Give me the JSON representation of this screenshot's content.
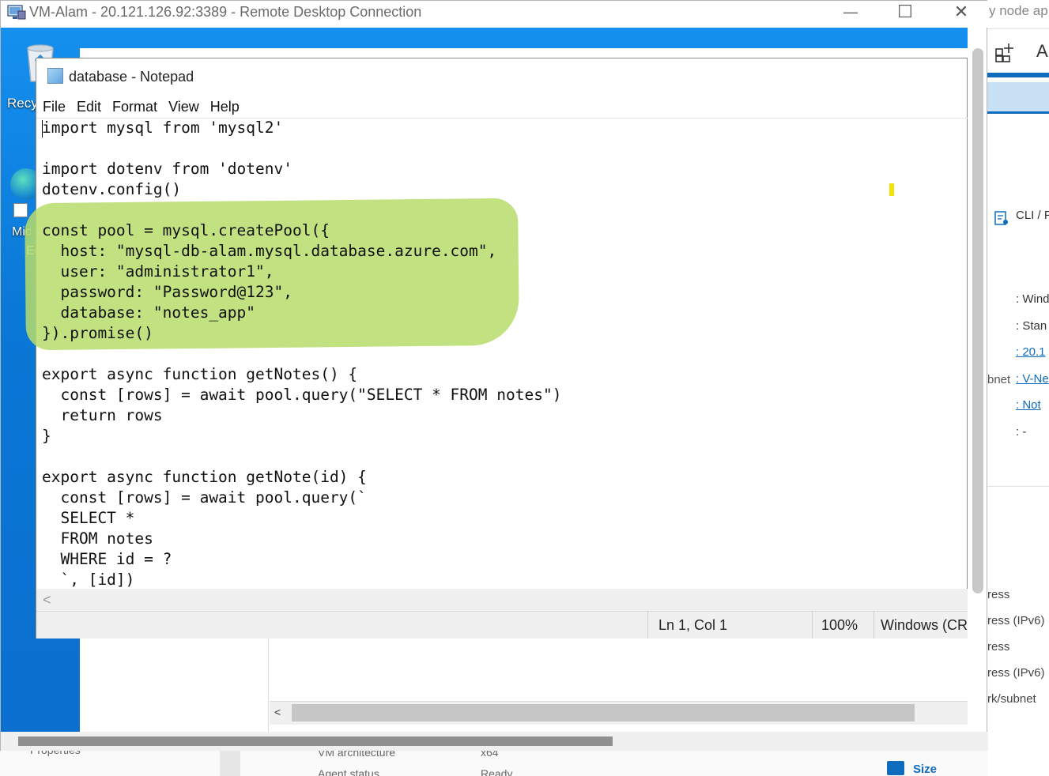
{
  "rdp": {
    "title": "VM-Alam - 20.121.126.92:3389 - Remote Desktop Connection",
    "minimize_icon": "—",
    "maximize_icon": "☐",
    "close_icon": "✕"
  },
  "desktop": {
    "recycle_label": "Recy",
    "edge_label_1": "Mic",
    "edge_label_2": "Ec"
  },
  "notepad": {
    "title": "database - Notepad",
    "menu": [
      "File",
      "Edit",
      "Format",
      "View",
      "Help"
    ],
    "code": "import mysql from 'mysql2'\n\nimport dotenv from 'dotenv'\ndotenv.config()\n\nconst pool = mysql.createPool({\n  host: \"mysql-db-alam.mysql.database.azure.com\",\n  user: \"administrator1\",\n  password: \"Password@123\",\n  database: \"notes_app\"\n}).promise()\n\nexport async function getNotes() {\n  const [rows] = await pool.query(\"SELECT * FROM notes\")\n  return rows\n}\n\nexport async function getNote(id) {\n  const [rows] = await pool.query(`\n  SELECT *\n  FROM notes\n  WHERE id = ?\n  `, [id])",
    "status": {
      "position": "Ln 1, Col 1",
      "zoom": "100%",
      "line_ending": "Windows (CRL"
    },
    "hscroll_left_icon": "<"
  },
  "background_portal": {
    "tab_title": "y node ap",
    "toolbar_icon_a": "A",
    "cli_label": "CLI / P",
    "properties": [
      {
        "text": ": Wind",
        "link": false
      },
      {
        "text": ": Stan",
        "link": false
      },
      {
        "text": ": 20.1",
        "link": true
      },
      {
        "text": ": V-Ne",
        "link": true
      },
      {
        "text": ": Not",
        "link": true
      },
      {
        "text": ": -",
        "link": false
      }
    ],
    "subnet_label": "bnet",
    "network_labels": [
      "ress",
      "ress (IPv6)",
      "ress",
      "ress (IPv6)",
      "rk/subnet"
    ],
    "bottom_labels": [
      "Properties",
      "VM architecture",
      "x64",
      "Agent status",
      "Ready"
    ],
    "size_label": "Size"
  },
  "inner_window": {
    "hscroll_left_icon": "<"
  }
}
